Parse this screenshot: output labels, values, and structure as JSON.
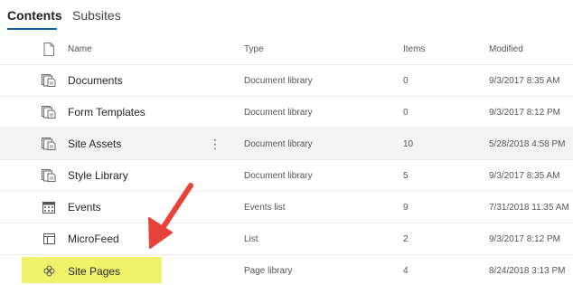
{
  "tabs": [
    {
      "label": "Contents",
      "active": true
    },
    {
      "label": "Subsites",
      "active": false
    }
  ],
  "columns": {
    "name": "Name",
    "type": "Type",
    "items": "Items",
    "modified": "Modified"
  },
  "rows": [
    {
      "icon": "document-library-icon",
      "name": "Documents",
      "type": "Document library",
      "items": "0",
      "modified": "9/3/2017 8:35 AM"
    },
    {
      "icon": "document-library-icon",
      "name": "Form Templates",
      "type": "Document library",
      "items": "0",
      "modified": "9/3/2017 8:12 PM"
    },
    {
      "icon": "document-library-icon",
      "name": "Site Assets",
      "type": "Document library",
      "items": "10",
      "modified": "5/28/2018 4:58 PM"
    },
    {
      "icon": "document-library-icon",
      "name": "Style Library",
      "type": "Document library",
      "items": "5",
      "modified": "9/3/2017 8:35 AM"
    },
    {
      "icon": "calendar-list-icon",
      "name": "Events",
      "type": "Events list",
      "items": "9",
      "modified": "7/31/2018 11:35 AM"
    },
    {
      "icon": "list-icon",
      "name": "MicroFeed",
      "type": "List",
      "items": "2",
      "modified": "9/3/2017 8:12 PM"
    },
    {
      "icon": "page-library-icon",
      "name": "Site Pages",
      "type": "Page library",
      "items": "4",
      "modified": "8/24/2018 3:13 PM"
    }
  ],
  "more_options_glyph": "⋮",
  "colors": {
    "accent": "#0b5ea8",
    "highlight": "#f0f36a",
    "arrow": "#e8433a",
    "row_hover": "#f3f3f3"
  }
}
